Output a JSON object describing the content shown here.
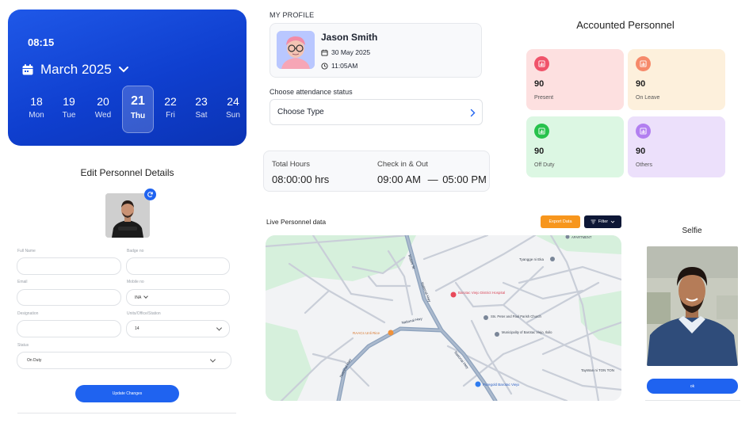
{
  "calendar": {
    "time": "08:15",
    "month": "March 2025",
    "days": [
      {
        "num": "18",
        "weekday": "Mon",
        "selected": false
      },
      {
        "num": "19",
        "weekday": "Tue",
        "selected": false
      },
      {
        "num": "20",
        "weekday": "Wed",
        "selected": false
      },
      {
        "num": "21",
        "weekday": "Thu",
        "selected": true
      },
      {
        "num": "22",
        "weekday": "Fri",
        "selected": false
      },
      {
        "num": "23",
        "weekday": "Sat",
        "selected": false
      },
      {
        "num": "24",
        "weekday": "Sun",
        "selected": false
      }
    ]
  },
  "edit_form": {
    "title": "Edit Personnel Details",
    "full_name_label": "Full Name",
    "full_name_value": "",
    "badge_label": "Badge no",
    "badge_value": "",
    "email_label": "Email",
    "email_value": "",
    "mobile_label": "Mobile no",
    "mobile_code": "INA",
    "designation_label": "Designation",
    "designation_value": "",
    "units_label": "Units/Office/Station",
    "units_value": "14",
    "status_label": "Status",
    "status_value": "On Duty",
    "update_button": "Update Changes"
  },
  "profile": {
    "section_label": "MY PROFILE",
    "name": "Jason Smith",
    "date": "30 May 2025",
    "time": "11:05AM",
    "attendance_label": "Choose attendance status",
    "attendance_value": "Choose Type",
    "total_hours_label": "Total Hours",
    "total_hours_value": "08:00:00 hrs",
    "checkinout_label": "Check in & Out",
    "checkin_value": "09:00 AM",
    "checkout_sep": "—",
    "checkout_value": "05:00 PM"
  },
  "accounted": {
    "title": "Accounted Personnel",
    "stats": [
      {
        "count": "90",
        "label": "Present",
        "bg": "#fde0e0",
        "icon_bg": "#f0536a"
      },
      {
        "count": "90",
        "label": "On Leave",
        "bg": "#fdf0dc",
        "icon_bg": "#f6896a"
      },
      {
        "count": "90",
        "label": "Off Duty",
        "bg": "#dcf7e3",
        "icon_bg": "#27c24c"
      },
      {
        "count": "90",
        "label": "Others",
        "bg": "#ece0fb",
        "icon_bg": "#b27ff0"
      }
    ]
  },
  "live": {
    "label": "Live Personnel data",
    "export_button": "Export Data",
    "filter_button": "Filter",
    "map_labels": {
      "road_top": "National Hwy",
      "road_left": "National Hwy",
      "road_right": "National Hwy",
      "road_vertical": "Mabini St",
      "hospital": "Barotac Viejo District Hospital",
      "church": "Sts. Peter and Paul Parish Church",
      "municipality": "Municipality of Barotac Viejo, Iloilo",
      "tyangge": "Tyangge ni Eka",
      "raacs": "RAACs Unli Rice",
      "puregold": "Puregold Barotac Viejo",
      "taywan": "TayWan ni TON TON",
      "apartment": "APARTMENT"
    }
  },
  "selfie": {
    "title": "Selfie",
    "ok_button": "ok"
  },
  "colors": {
    "accent": "#1f63f0",
    "export": "#f7961d",
    "filter": "#0d1736"
  }
}
